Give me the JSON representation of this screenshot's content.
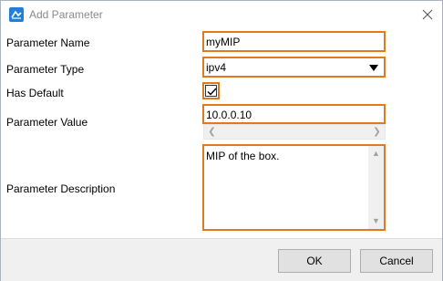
{
  "window": {
    "title": "Add Parameter"
  },
  "form": {
    "name_label": "Parameter Name",
    "name_value": "myMIP",
    "type_label": "Parameter Type",
    "type_value": "ipv4",
    "default_label": "Has Default",
    "default_checked": true,
    "value_label": "Parameter Value",
    "value_value": "10.0.0.10",
    "description_label": "Parameter Description",
    "description_value": "MIP of the box."
  },
  "buttons": {
    "ok_label": "OK",
    "cancel_label": "Cancel"
  },
  "colors": {
    "highlight": "#e07a1f",
    "app_icon": "#1f7fd9"
  }
}
